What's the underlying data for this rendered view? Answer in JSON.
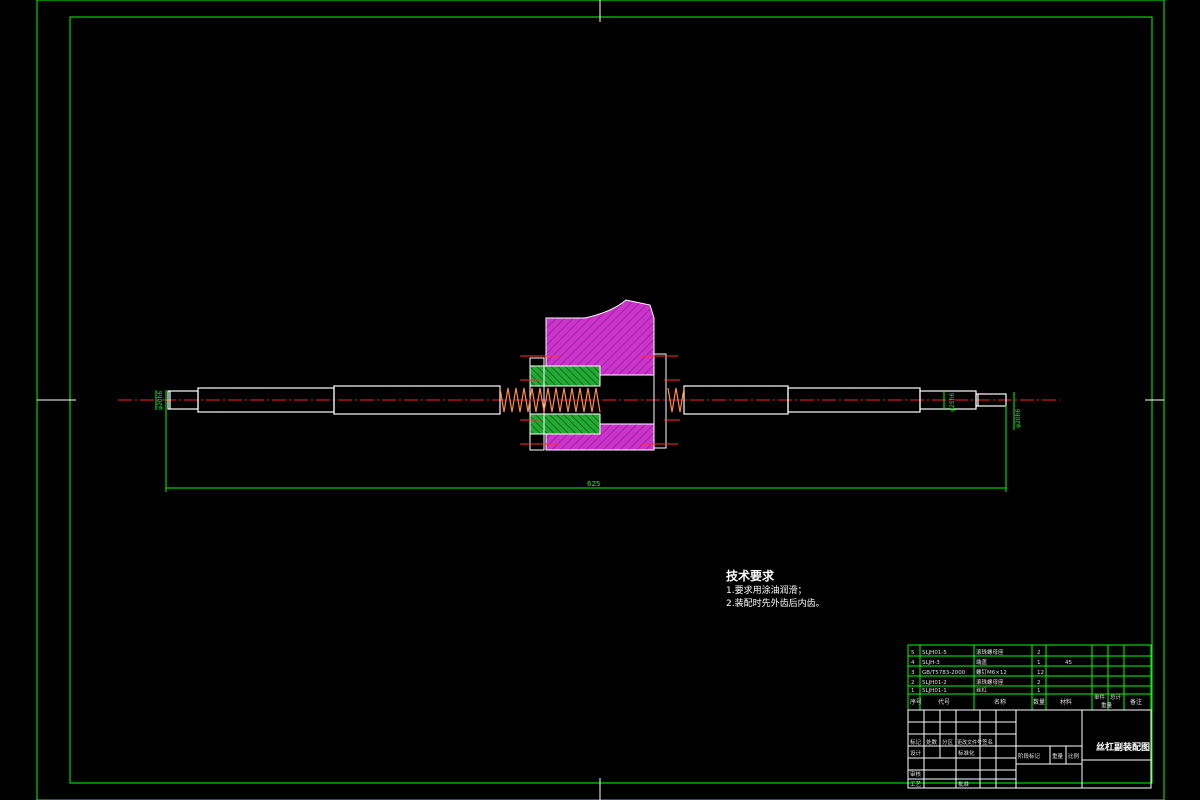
{
  "drawing": {
    "title_block_name": "丝杠副装配图",
    "overall_dimension": "625",
    "diameter_dims": [
      "φ20h6",
      "φ25h6",
      "φ20h6"
    ],
    "tech_requirements": {
      "heading": "技术要求",
      "items": [
        "1.要求用涂油润滑；",
        "2.装配时先外齿后内齿。"
      ]
    },
    "parts_list": [
      {
        "no": "5",
        "code": "SLJH01-5",
        "name": "滚珠螺母座",
        "qty": "2",
        "material": ""
      },
      {
        "no": "4",
        "code": "SLJH-3",
        "name": "端盖",
        "qty": "1",
        "material": "45"
      },
      {
        "no": "3",
        "code": "GB/T5783-2000",
        "name": "螺钉M6×12",
        "qty": "12",
        "material": ""
      },
      {
        "no": "2",
        "code": "SLJH01-2",
        "name": "滚珠螺母座",
        "qty": "2",
        "material": ""
      },
      {
        "no": "1",
        "code": "SLJH01-1",
        "name": "丝杠",
        "qty": "1",
        "material": ""
      }
    ],
    "parts_header": {
      "seq": "序号",
      "code": "代号",
      "name": "名称",
      "qty": "数量",
      "material": "材料",
      "unit_weight": "单件",
      "total_weight": "总计",
      "weight": "重量",
      "remark": "备注"
    },
    "title_block": {
      "mark": "标记",
      "count": "处数",
      "zone": "分区",
      "change_doc": "更改文件号",
      "sign": "签名",
      "design": "设计",
      "standardize": "标准化",
      "review": "审核",
      "craft": "工艺",
      "approve": "批准",
      "stage_mark": "阶段标记",
      "weight": "重量",
      "scale": "比例"
    }
  },
  "colors": {
    "border": "#00ff00",
    "part_outline": "#ffffff",
    "hatch_fill": "#cc33cc",
    "nut_fill": "#22aa33",
    "centerline": "#ff2020",
    "dimension": "#00ff00"
  }
}
